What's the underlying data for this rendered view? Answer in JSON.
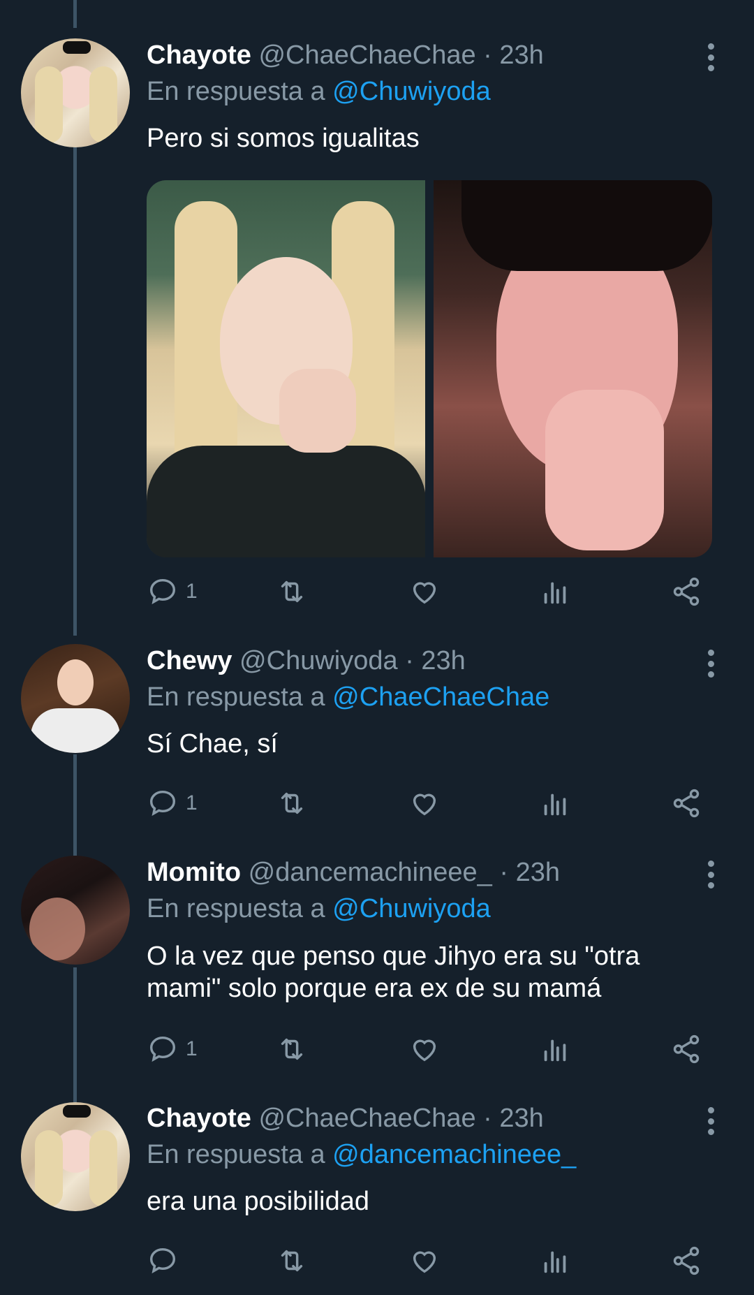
{
  "tweets": [
    {
      "name": "Chayote",
      "handle": "@ChaeChaeChae",
      "time": "· 23h",
      "reply_prefix": "En respuesta a",
      "reply_to": "@Chuwiyoda",
      "text": "Pero si somos igualitas",
      "reply_count": "1",
      "has_media": true
    },
    {
      "name": "Chewy",
      "handle": "@Chuwiyoda",
      "time": "· 23h",
      "reply_prefix": "En respuesta a",
      "reply_to": "@ChaeChaeChae",
      "text": "Sí Chae, sí",
      "reply_count": "1"
    },
    {
      "name": "Momito",
      "handle": "@dancemachineee_",
      "time": "· 23h",
      "reply_prefix": "En respuesta a",
      "reply_to": "@Chuwiyoda",
      "text": "O la vez que penso que Jihyo  era su \"otra mami\" solo porque era ex de su mamá",
      "reply_count": "1"
    },
    {
      "name": "Chayote",
      "handle": "@ChaeChaeChae",
      "time": "· 23h",
      "reply_prefix": "En respuesta a",
      "reply_to": "@dancemachineee_",
      "text": "era una posibilidad",
      "reply_count": ""
    }
  ],
  "colors": {
    "background": "#15202b",
    "muted": "#8899a6",
    "link": "#1da1f2",
    "thread_line": "#3d5466"
  },
  "icons": [
    "reply-icon",
    "retweet-icon",
    "like-icon",
    "analytics-icon",
    "share-icon",
    "more-icon"
  ]
}
